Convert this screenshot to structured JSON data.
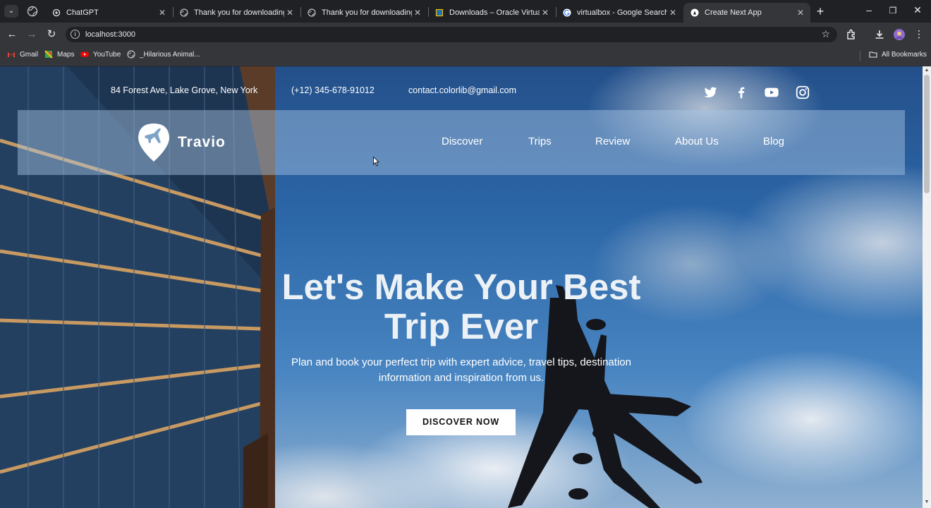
{
  "browser": {
    "tabs": [
      {
        "title": "ChatGPT",
        "icon": "chatgpt-icon"
      },
      {
        "title": "Thank you for downloading UI",
        "icon": "globe-icon"
      },
      {
        "title": "Thank you for downloading UI",
        "icon": "globe-icon"
      },
      {
        "title": "Downloads – Oracle VirtualBox",
        "icon": "virtualbox-icon"
      },
      {
        "title": "virtualbox - Google Search",
        "icon": "google-icon"
      },
      {
        "title": "Create Next App",
        "icon": "nextjs-icon",
        "active": true
      }
    ],
    "url": "localhost:3000",
    "bookmarks": [
      {
        "label": "Gmail",
        "icon": "gmail-icon"
      },
      {
        "label": "Maps",
        "icon": "maps-icon"
      },
      {
        "label": "YouTube",
        "icon": "youtube-icon"
      },
      {
        "label": "_Hilarious Animal...",
        "icon": "globe-icon"
      }
    ],
    "all_bookmarks": "All Bookmarks"
  },
  "page": {
    "contact": {
      "address": "84 Forest Ave, Lake Grove, New York",
      "phone": "(+12) 345-678-91012",
      "email": "contact.colorlib@gmail.com"
    },
    "social": [
      "twitter-icon",
      "facebook-icon",
      "youtube-icon",
      "instagram-icon"
    ],
    "logo_text": "Travio",
    "nav": [
      "Discover",
      "Trips",
      "Review",
      "About Us",
      "Blog"
    ],
    "hero": {
      "headline_line1": "Let's Make Your Best",
      "headline_line2": "Trip Ever",
      "subtitle_line1": "Plan and book your perfect trip with expert advice, travel tips, destination",
      "subtitle_line2": "information and inspiration from us.",
      "cta": "DISCOVER NOW"
    }
  },
  "colors": {
    "chrome_dark": "#202124",
    "chrome_toolbar": "#35363a",
    "sky": "#2c67a8",
    "cta_bg": "#ffffff"
  }
}
